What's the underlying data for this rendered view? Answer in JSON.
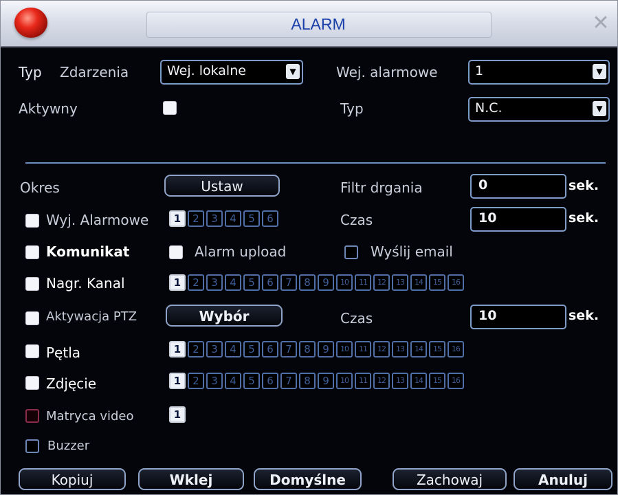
{
  "window": {
    "title": "ALARM",
    "close_icon": "close-icon",
    "logo_icon": "logo-icon"
  },
  "form": {
    "typ_label": "Typ",
    "zdarzenia_label": "Zdarzenia",
    "zdarzenia_value": "Wej. lokalne",
    "wej_alarmowe_label": "Wej. alarmowe",
    "wej_alarmowe_value": "1",
    "aktywny_label": "Aktywny",
    "typ2_label": "Typ",
    "typ2_value": "N.C.",
    "okres_label": "Okres",
    "ustaw_label": "Ustaw",
    "filtr_label": "Filtr drgania",
    "filtr_value": "0",
    "sek1": "sek.",
    "wyj_label": "Wyj. Alarmowe",
    "czas1_label": "Czas",
    "czas1_value": "10",
    "sek2": "sek.",
    "komunikat_label": "Komunikat",
    "alarm_upload_label": "Alarm upload",
    "wyslij_email_label": "Wyślij email",
    "nagr_label": "Nagr. Kanal",
    "ptz_label": "Aktywacja PTZ",
    "wybor_label": "Wybór",
    "czas2_label": "Czas",
    "czas2_value": "10",
    "sek3": "sek.",
    "petla_label": "Pętla",
    "zdjecie_label": "Zdjęcie",
    "matryca_label": "Matryca video",
    "buzzer_label": "Buzzer"
  },
  "channels6": [
    "1",
    "2",
    "3",
    "4",
    "5",
    "6"
  ],
  "channels16": [
    "1",
    "2",
    "3",
    "4",
    "5",
    "6",
    "7",
    "8",
    "9",
    "10",
    "11",
    "12",
    "13",
    "14",
    "15",
    "16"
  ],
  "matryca_channels": [
    "1"
  ],
  "buttons": {
    "kopiuj": "Kopiuj",
    "wklej": "Wklej",
    "domyslne": "Domyślne",
    "zachowaj": "Zachowaj",
    "anuluj": "Anuluj"
  },
  "colors": {
    "accent": "#7d9cc9",
    "title": "#1a3fa8",
    "background": "#03050a"
  }
}
